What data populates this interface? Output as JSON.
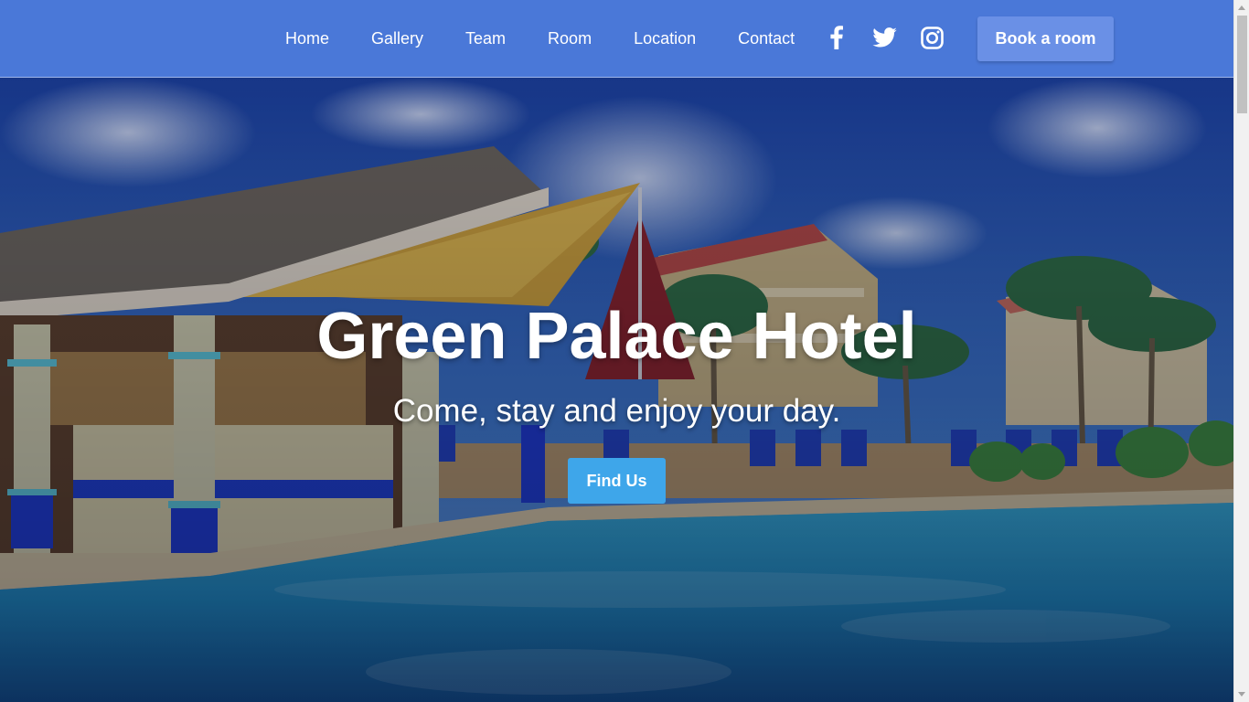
{
  "navbar": {
    "links": [
      {
        "label": "Home"
      },
      {
        "label": "Gallery"
      },
      {
        "label": "Team"
      },
      {
        "label": "Room"
      },
      {
        "label": "Location"
      },
      {
        "label": "Contact"
      }
    ],
    "socials": [
      {
        "icon": "facebook-icon"
      },
      {
        "icon": "twitter-icon"
      },
      {
        "icon": "instagram-icon"
      }
    ],
    "book_label": "Book a room"
  },
  "hero": {
    "title": "Green Palace Hotel",
    "subtitle": "Come, stay and enjoy your day.",
    "cta_label": "Find Us",
    "background": "hotel-pool-photo"
  },
  "colors": {
    "navbar": "#4a78d8",
    "book_button": "#6a90e6",
    "cta_button": "#3ea6ea",
    "text": "#ffffff"
  }
}
